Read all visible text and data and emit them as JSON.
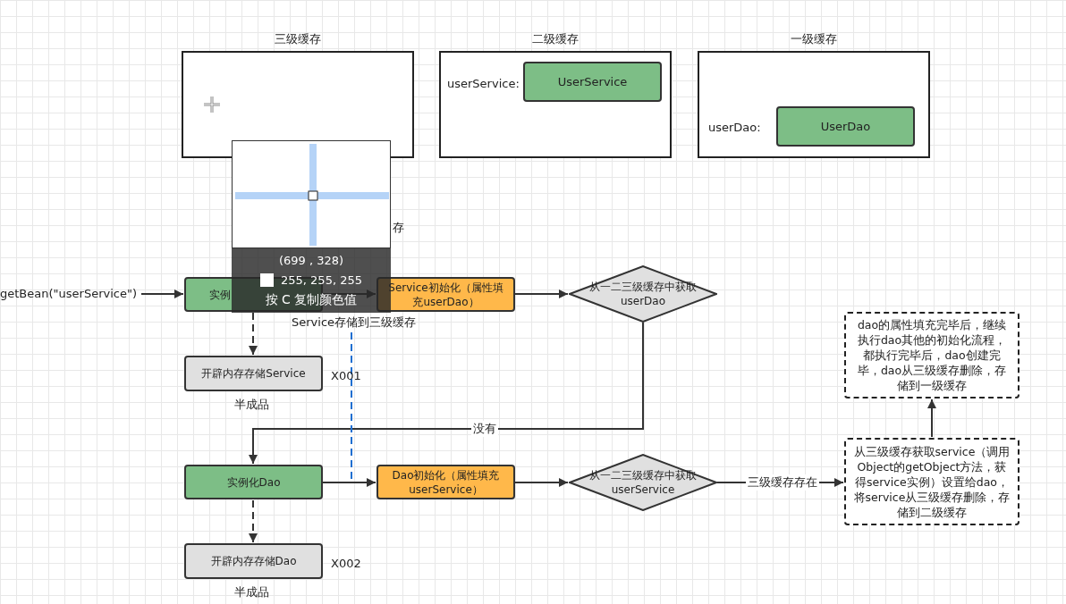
{
  "cache_panels": [
    {
      "title": "三级缓存"
    },
    {
      "title": "二级缓存",
      "entries": [
        {
          "label": "userService:",
          "value": "UserService"
        }
      ]
    },
    {
      "title": "一级缓存",
      "entries": [
        {
          "label": "userDao:",
          "value": "UserDao"
        }
      ]
    }
  ],
  "nodes": [
    {
      "kind": "instantiate",
      "text": "实例"
    },
    {
      "kind": "memory",
      "text": "开辟内存存储Service"
    },
    {
      "kind": "init",
      "text": "Service初始化（属性填充userDao）"
    },
    {
      "kind": "decision",
      "text": "从一二三级缓存中获取 userDao"
    },
    {
      "kind": "instantiate",
      "text": "实例化Dao"
    },
    {
      "kind": "memory",
      "text": "开辟内存存储Dao"
    },
    {
      "kind": "init",
      "text": "Dao初始化（属性填充userService）"
    },
    {
      "kind": "decision",
      "text": "从一二三级缓存中获取 userService"
    },
    {
      "kind": "note",
      "text": "dao的属性填充完毕后，继续执行dao其他的初始化流程，都执行完毕后，dao创建完毕，dao从三级缓存删除，存储到一级缓存"
    },
    {
      "kind": "note",
      "text": "从三级缓存获取service（调用Object的getObject方法，获得service实例）设置给dao，将service从三级缓存删除，存储到二级缓存"
    }
  ],
  "labels": [
    "getBean(\"userService\")",
    "X001",
    "半成品",
    "X002",
    "半成品",
    "存",
    "Service存储到三级缓存"
  ],
  "edge_labels": [
    "没有",
    "三级缓存存在"
  ],
  "color_picker": {
    "coordinates": "(699 , 328)",
    "rgb": "255, 255, 255",
    "hint": "按 C 复制颜色值"
  }
}
